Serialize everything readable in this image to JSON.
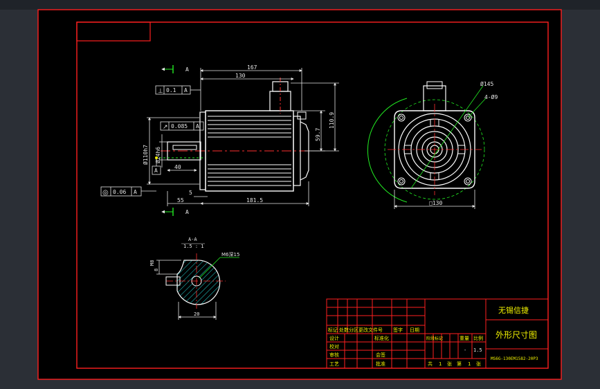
{
  "colors": {
    "background": "#000000",
    "frame": "#ff2020",
    "outline": "#ffffff",
    "dimension": "#e6e6e6",
    "construction": "#22ee22",
    "hatch": "#22dddd",
    "center_line": "#ff3030",
    "title_text": "#f0f000",
    "table_line": "#ff2020"
  },
  "side_view": {
    "overall_length": "167",
    "body_length": "130",
    "frame_length": "181.5",
    "flange_to_shaft": "55",
    "flange_thickness": "5",
    "shaft_key_length": "40",
    "height_upper": "59.7",
    "height_total": "110.9",
    "spigot_diameter": "Ø110h7",
    "shaft_diameter": "Ø24h6",
    "section_marker_top": "A",
    "section_marker_bottom": "A"
  },
  "tolerances": {
    "perpendicularity": {
      "symbol": "⊥",
      "value": "0.1",
      "datum": "A"
    },
    "runout": {
      "symbol": "↗",
      "value": "0.085",
      "datum": "A"
    },
    "concentricity": {
      "symbol": "◎",
      "value": "0.06",
      "datum": "A"
    },
    "datum_label": "A"
  },
  "front_view": {
    "pcd": "Ø145",
    "hole": "4-Ø9",
    "square": "□130"
  },
  "section_view": {
    "title": "A-A",
    "scale": "1.5 : 1",
    "key_width": "8",
    "key_depth": "M8",
    "thread": "M6深15",
    "diameter": "20"
  },
  "title_block": {
    "company": "无锡信捷",
    "drawing_title": "外形尺寸图",
    "drawing_number": "MS6G-130EM1582-20P3",
    "header_row": [
      "标记",
      "处数",
      "分区",
      "更改文件号",
      "签字",
      "日期"
    ],
    "rows": [
      [
        "设计",
        "",
        "标准化",
        ""
      ],
      [
        "校对",
        "",
        "",
        ""
      ],
      [
        "审核",
        "",
        "会签",
        ""
      ],
      [
        "工艺",
        "",
        "批准",
        ""
      ]
    ],
    "stage_label": "阶段标记",
    "weight_label": "重量",
    "scale_label": "比例",
    "weight_value": "-",
    "scale_value": "1.5",
    "sheets": [
      "共",
      "1",
      "张",
      "第",
      "1",
      "张"
    ]
  }
}
